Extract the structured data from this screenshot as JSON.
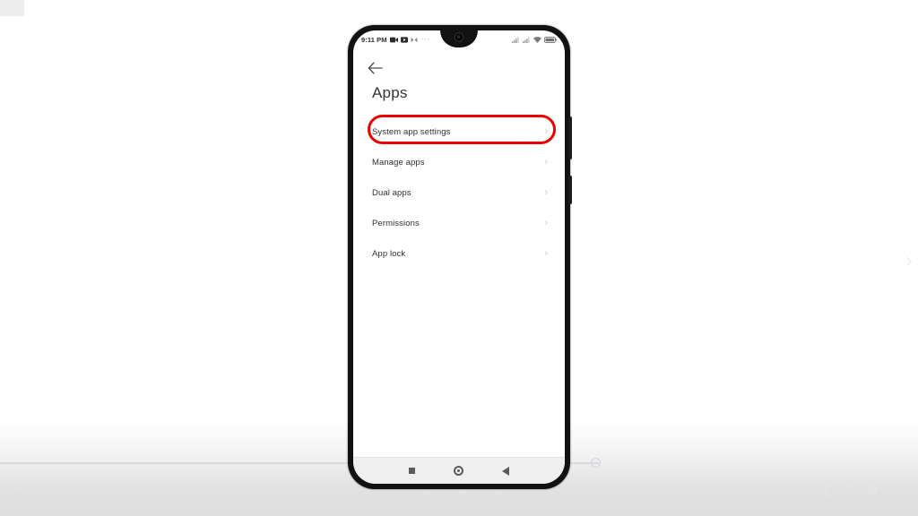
{
  "background": {
    "right_chevron_icon": "chevron-right-icon",
    "scrubber": {
      "name": "progress-scrubber",
      "handle_icon": "scrubber-handle"
    },
    "faint_controls": {
      "left": [
        "equalizer-icon",
        "subtitles-icon"
      ],
      "center": [
        "repeat-icon",
        "play-icon",
        "shuffle-icon"
      ],
      "right": [
        "cast-icon",
        "fullscreen-icon",
        "settings-icon"
      ]
    }
  },
  "phone": {
    "hardware": {
      "volume_button": "volume-rocker",
      "power_button": "power-button",
      "camera": "front-camera"
    },
    "status_bar": {
      "clock": "9:11 PM",
      "left_icons": [
        "video-recorder-icon",
        "screen-record-icon",
        "silent-mode-icon"
      ],
      "overflow": "···",
      "right_icons": [
        "signal-1-icon",
        "signal-2-icon",
        "wifi-icon",
        "battery-icon"
      ]
    },
    "app_bar": {
      "back_icon": "back-arrow-icon",
      "title": "Apps"
    },
    "list": {
      "items": [
        {
          "label": "System app settings",
          "chevron": "›",
          "highlighted": true
        },
        {
          "label": "Manage apps",
          "chevron": "›",
          "highlighted": false
        },
        {
          "label": "Dual apps",
          "chevron": "›",
          "highlighted": false
        },
        {
          "label": "Permissions",
          "chevron": "›",
          "highlighted": false
        },
        {
          "label": "App lock",
          "chevron": "›",
          "highlighted": false
        }
      ]
    },
    "navigation_bar": {
      "recent_icon": "recent-apps-icon",
      "home_icon": "home-icon",
      "back_icon": "back-nav-icon"
    }
  },
  "annotation": {
    "name": "red-highlight-oval",
    "target": "System app settings",
    "color": "#ee0000"
  }
}
